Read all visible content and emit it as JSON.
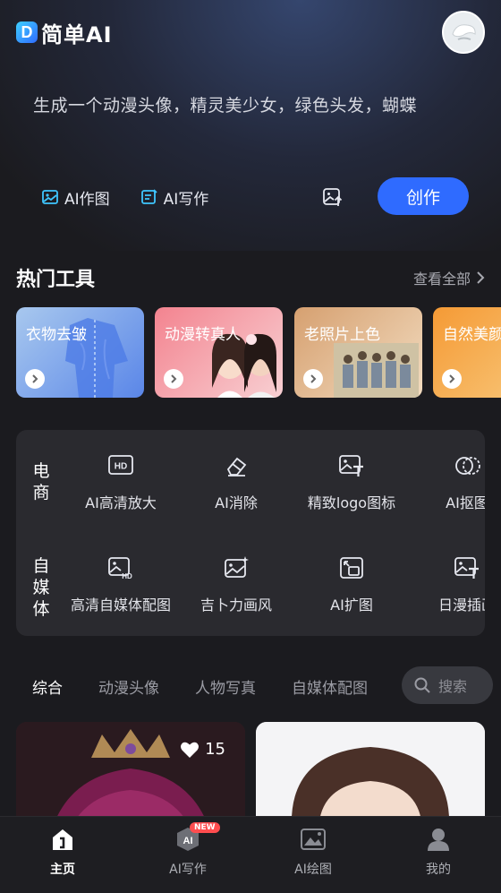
{
  "header": {
    "app_name": "简单AI",
    "logo_letter": "D"
  },
  "prompt": {
    "text": "生成一个动漫头像，精灵美少女，绿色头发，蝴蝶"
  },
  "modes": [
    {
      "label": "AI作图",
      "icon": "image-icon"
    },
    {
      "label": "AI写作",
      "icon": "edit-icon"
    }
  ],
  "create_label": "创作",
  "hot_tools": {
    "title": "热门工具",
    "see_all": "查看全部",
    "cards": [
      {
        "label": "衣物去皱",
        "color_from": "#8fb8ea",
        "color_to": "#5a86e8"
      },
      {
        "label": "动漫转真人",
        "color_from": "#f48e9a",
        "color_to": "#f7c5c9"
      },
      {
        "label": "老照片上色",
        "color_from": "#d8a575",
        "color_to": "#f1d8b8"
      },
      {
        "label": "自然美颜",
        "color_from": "#f6a03c",
        "color_to": "#f7c77a"
      }
    ]
  },
  "tool_grid": {
    "rows": [
      {
        "category": [
          "电",
          "商"
        ],
        "items": [
          {
            "label": "AI高清放大",
            "icon": "hd-icon"
          },
          {
            "label": "AI消除",
            "icon": "eraser-icon"
          },
          {
            "label": "精致logo图标",
            "icon": "image-text-icon"
          },
          {
            "label": "AI抠图",
            "icon": "cutout-icon"
          }
        ]
      },
      {
        "category": [
          "自",
          "媒",
          "体"
        ],
        "items": [
          {
            "label": "高清自媒体配图",
            "icon": "image-hd-icon"
          },
          {
            "label": "吉卜力画风",
            "icon": "image-sparkle-icon"
          },
          {
            "label": "AI扩图",
            "icon": "expand-image-icon"
          },
          {
            "label": "日漫插画",
            "icon": "image-text-icon"
          }
        ]
      }
    ]
  },
  "filters": {
    "tabs": [
      "综合",
      "动漫头像",
      "人物写真",
      "自媒体配图"
    ],
    "active": 0,
    "search_placeholder": "搜索"
  },
  "feed": [
    {
      "likes": "15"
    },
    {
      "likes": ""
    }
  ],
  "tabbar": {
    "items": [
      {
        "label": "主页",
        "icon": "home-icon",
        "active": true
      },
      {
        "label": "AI写作",
        "icon": "ai-write-icon",
        "badge": "NEW"
      },
      {
        "label": "AI绘图",
        "icon": "ai-draw-icon"
      },
      {
        "label": "我的",
        "icon": "profile-icon"
      }
    ]
  },
  "colors": {
    "accent": "#2f6bff",
    "background": "#1b1b1f",
    "panel": "#2a2a2f"
  }
}
